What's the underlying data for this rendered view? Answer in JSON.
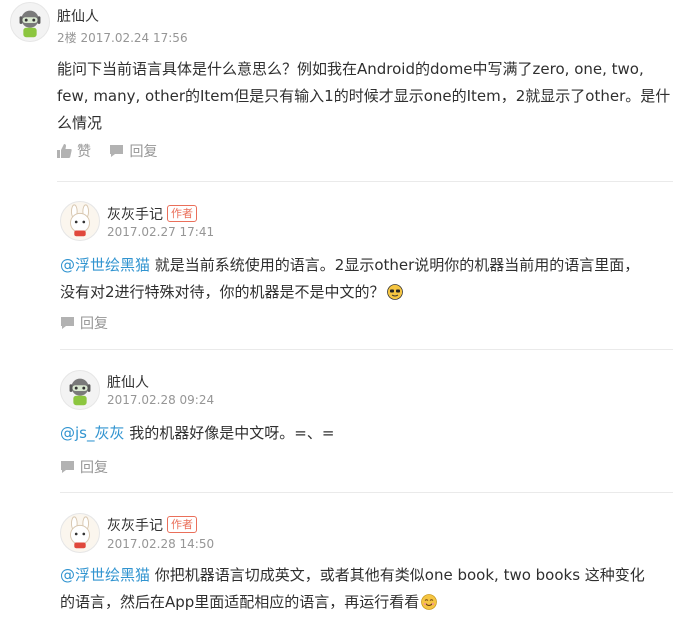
{
  "comment": {
    "author": "脏仙人",
    "floor": "2楼",
    "date": "2017.02.24 17:56",
    "text_lines": [
      "能问下当前语言具体是什么意思么？例如我在Android的dome中写满了zero, one, two,",
      "few, many, other的Item但是只有输入1的时候才显示one的Item，2就显示了other。是什",
      "么情况"
    ],
    "like_label": "赞",
    "reply_label": "回复"
  },
  "replies": [
    {
      "author": "灰灰手记",
      "badge": "作者",
      "date": "2017.02.27 17:41",
      "mention": "@浮世绘黑猫",
      "text_first": " 就是当前系统使用的语言。2显示other说明你的机器当前用的语言里面，",
      "text_second": "没有对2进行特殊对待，你的机器是不是中文的？",
      "emoji": "sunglasses-face",
      "reply_label": "回复"
    },
    {
      "author": "脏仙人",
      "date": "2017.02.28 09:24",
      "mention": "@js_灰灰",
      "text_first": " 我的机器好像是中文呀。=、=",
      "reply_label": "回复"
    },
    {
      "author": "灰灰手记",
      "badge": "作者",
      "date": "2017.02.28 14:50",
      "mention": "@浮世绘黑猫",
      "text_first": " 你把机器语言切成英文，或者其他有类似one book, two books 这种变化",
      "text_second": "的语言，然后在App里面适配相应的语言，再运行看看",
      "emoji": "smiling-face"
    }
  ],
  "colors": {
    "link": "#3194d0",
    "author_badge": "#ea6f5a",
    "muted": "#969696"
  }
}
